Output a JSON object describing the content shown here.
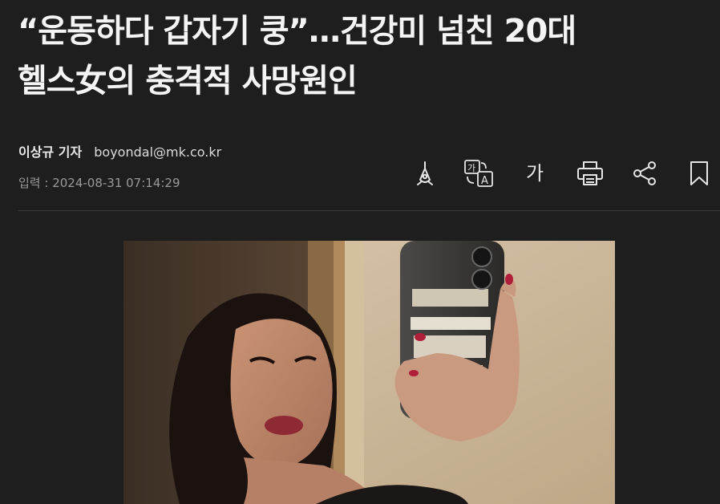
{
  "article": {
    "headline_line1": "“운동하다 갑자기 쿵”…건강미 넘친 20대",
    "headline_line2": "헬스女의 충격적 사망원인",
    "author": "이상규 기자",
    "email": "boyondal@mk.co.kr",
    "date_label": "입력 : 2024-08-31 07:14:29"
  },
  "toolbar": {
    "font_size_label": "가",
    "icons": [
      "pen-nib-icon",
      "translate-icon",
      "font-size-icon",
      "print-icon",
      "share-icon",
      "bookmark-icon"
    ]
  },
  "colors": {
    "background": "#1e1e1e",
    "headline": "#f4f4f4",
    "muted": "#9a9a9a",
    "divider": "#3c3c3c"
  }
}
